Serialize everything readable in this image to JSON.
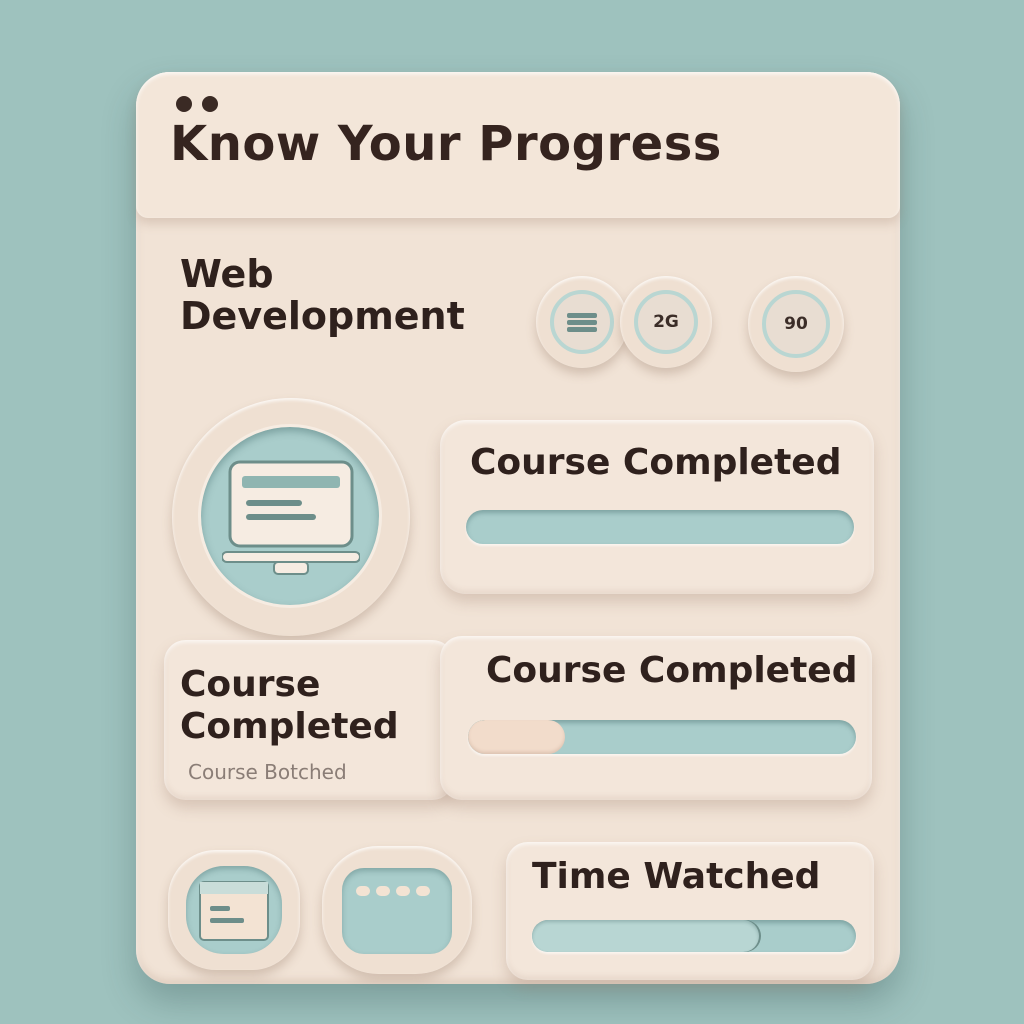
{
  "header": {
    "title": "Know Your Progress"
  },
  "course": {
    "name_line1": "Web",
    "name_line2": "Development"
  },
  "stats": {
    "value_a": "2G",
    "value_b": "90"
  },
  "course_completed_panel": {
    "label": "Course Completed",
    "progress_percent": 100
  },
  "course_completed_card": {
    "title_line1": "Course",
    "title_line2": "Completed",
    "subtitle": "Course Botched"
  },
  "second_progress_panel": {
    "label": "Course Completed",
    "progress_percent": 25
  },
  "time_watched_panel": {
    "label": "Time Watched",
    "progress_percent": 70
  },
  "colors": {
    "accent": "#a9cdcb",
    "panel": "#f1e3d6",
    "background": "#9ec2be",
    "text": "#2f211d"
  }
}
